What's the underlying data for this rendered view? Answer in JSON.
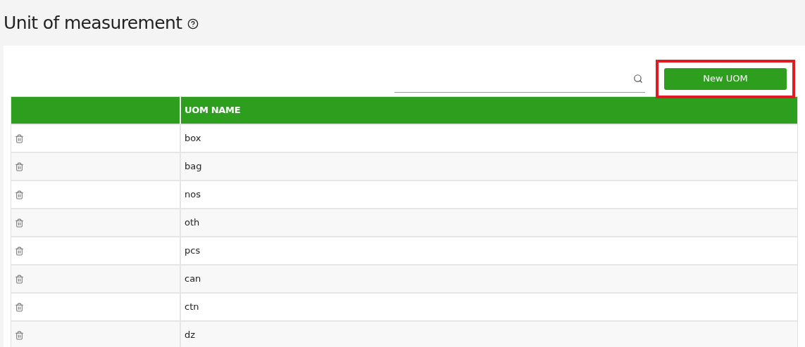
{
  "page_title": "Unit of measurement",
  "toolbar": {
    "new_button": "New UOM",
    "highlighted": true
  },
  "table": {
    "columns": [
      "UOM NAME"
    ],
    "rows": [
      {
        "name": "box"
      },
      {
        "name": "bag"
      },
      {
        "name": "nos"
      },
      {
        "name": "oth"
      },
      {
        "name": "pcs"
      },
      {
        "name": "can"
      },
      {
        "name": "ctn"
      },
      {
        "name": "dz"
      }
    ]
  }
}
